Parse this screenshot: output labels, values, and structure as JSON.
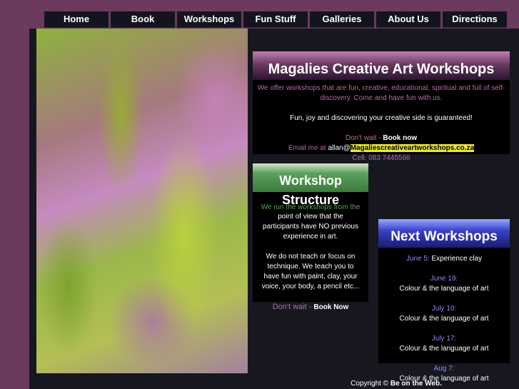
{
  "nav": {
    "items": [
      {
        "label": "Home"
      },
      {
        "label": "Book"
      },
      {
        "label": "Workshops"
      },
      {
        "label": "Fun Stuff"
      },
      {
        "label": "Galleries"
      },
      {
        "label": "About Us"
      },
      {
        "label": "Directions"
      }
    ]
  },
  "intro": {
    "title": "Magalies Creative Art Workshops",
    "line1": "We offer workshops that are fun, creative, educational, spiritual and full of self-",
    "line2": "discovery. Come and have fun with us.",
    "line3": "Fun, joy and discovering your creative side is guaranteed!",
    "dont_wait": "Don't wait - ",
    "book_now": "Book now",
    "email_prefix": "Email me at ",
    "email_user": "allan@",
    "email_domain": "Magaliescreativeartworkshops.co.za",
    "cell": "Cell: 083 7445566"
  },
  "structure": {
    "title_line1": "Workshop",
    "title_line2": "Structure",
    "p1_lines": [
      "We run the workshops from the",
      "point of view that the",
      "participants have NO previous",
      "experience in art."
    ],
    "p2_lines": [
      "We do not teach or focus on",
      "technique. We teach you to",
      "have fun with paint, clay, your",
      "voice, your body, a pencil etc..."
    ],
    "dont_wait": "Don't wait - ",
    "book_now": "Book Now"
  },
  "next": {
    "title": "Next Workshops",
    "events": [
      {
        "date": "June 5:",
        "desc": " Experience clay"
      },
      {
        "date": "June 19:",
        "desc": "Colour & the language of art"
      },
      {
        "date": "July 10:",
        "desc": "Colour & the language of art"
      },
      {
        "date": "July 17:",
        "desc": "Colour & the language of art"
      },
      {
        "date": "Aug 7:",
        "desc": "Colour & the language of art"
      }
    ]
  },
  "footer": {
    "prefix": "Copyright © ",
    "name": "Be on the Web."
  }
}
